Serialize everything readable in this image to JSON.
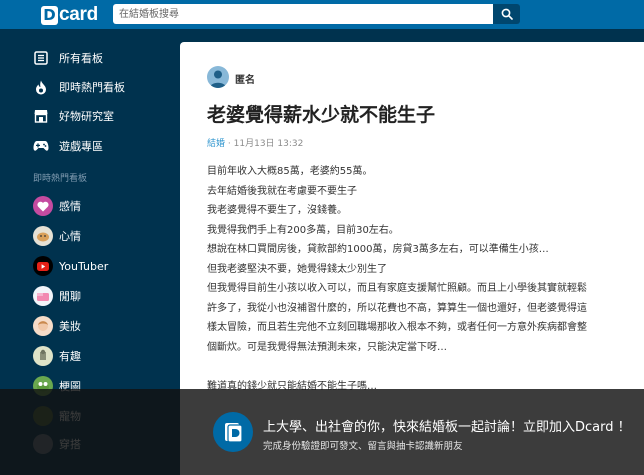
{
  "header": {
    "logo_letter": "D",
    "logo_text": "card",
    "search_placeholder": "在結婚板搜尋"
  },
  "sidebar": {
    "nav": [
      {
        "label": "所有看板",
        "icon": "grid-list-icon"
      },
      {
        "label": "即時熱門看板",
        "icon": "flame-icon"
      },
      {
        "label": "好物研究室",
        "icon": "shop-icon"
      },
      {
        "label": "遊戲專區",
        "icon": "gamepad-icon"
      }
    ],
    "section_title": "即時熱門看板",
    "forums": [
      {
        "label": "感情"
      },
      {
        "label": "心情"
      },
      {
        "label": "YouTuber"
      },
      {
        "label": "閒聊"
      },
      {
        "label": "美妝"
      },
      {
        "label": "有趣"
      },
      {
        "label": "梗圖"
      },
      {
        "label": "寵物"
      },
      {
        "label": "穿搭"
      }
    ]
  },
  "post": {
    "author": "匿名",
    "title": "老婆覺得薪水少就不能生子",
    "forum": "結婚",
    "separator": "·",
    "date": "11月13日 13:32",
    "lines": [
      "目前年收入大概85萬，老婆約55萬。",
      "去年結婚後我就在考慮要不要生子",
      "我老婆覺得不要生了，沒錢養。",
      "我覺得我們手上有200多萬，目前30左右。",
      "想說在林口買間房後，貸款部約1000萬，房貸3萬多左右，可以準備生小孩…",
      "但我老婆堅決不要，她覺得錢太少別生了",
      "但我覺得目前生小孩以收入可以，而且有家庭支援幫忙照顧。而且上小學後其實就輕鬆",
      "許多了，我從小也沒補習什麼的，所以花費也不高，算算生一個也還好，但老婆覺得這",
      "樣太冒險，而且若生完他不立刻回職場那收入根本不夠，或者任何一方意外疾病都會整",
      "個斷炊。可是我覺得無法預測未來，只能決定當下呀…",
      "",
      "難道真的錢少就只能結婚不能生子嗎…"
    ]
  },
  "banner": {
    "title": "上大學、出社會的你，快來結婚板一起討論！立即加入Dcard ！",
    "subtitle": "完成身份驗證即可發文、留言與抽卡認識新朋友"
  },
  "colors": {
    "header": "#006aa6",
    "sidebar": "#00324e",
    "link": "#3397cf"
  }
}
